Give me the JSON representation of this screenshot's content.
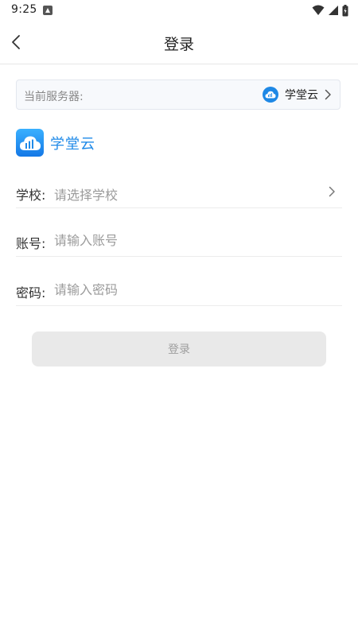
{
  "status_bar": {
    "time": "9:25",
    "icons": [
      "notification-icon",
      "wifi-icon",
      "signal-icon",
      "battery-icon"
    ]
  },
  "header": {
    "title": "登录",
    "back_icon": "chevron-left-icon"
  },
  "server": {
    "label": "当前服务器:",
    "name": "学堂云",
    "logo_icon": "cloud-logo-icon",
    "chevron_icon": "chevron-right-icon"
  },
  "brand": {
    "name": "学堂云",
    "logo_icon": "cloud-logo-icon"
  },
  "form": {
    "school": {
      "label": "学校:",
      "placeholder": "请选择学校",
      "chevron_icon": "chevron-right-icon"
    },
    "account": {
      "label": "账号:",
      "placeholder": "请输入账号"
    },
    "password": {
      "label": "密码:",
      "placeholder": "请输入密码"
    }
  },
  "login_button": {
    "label": "登录"
  },
  "colors": {
    "brand_blue": "#1f8ae8",
    "button_disabled_bg": "#e9e9e9",
    "button_disabled_text": "#9e9e9e",
    "server_card_bg": "#f7f9fc"
  }
}
